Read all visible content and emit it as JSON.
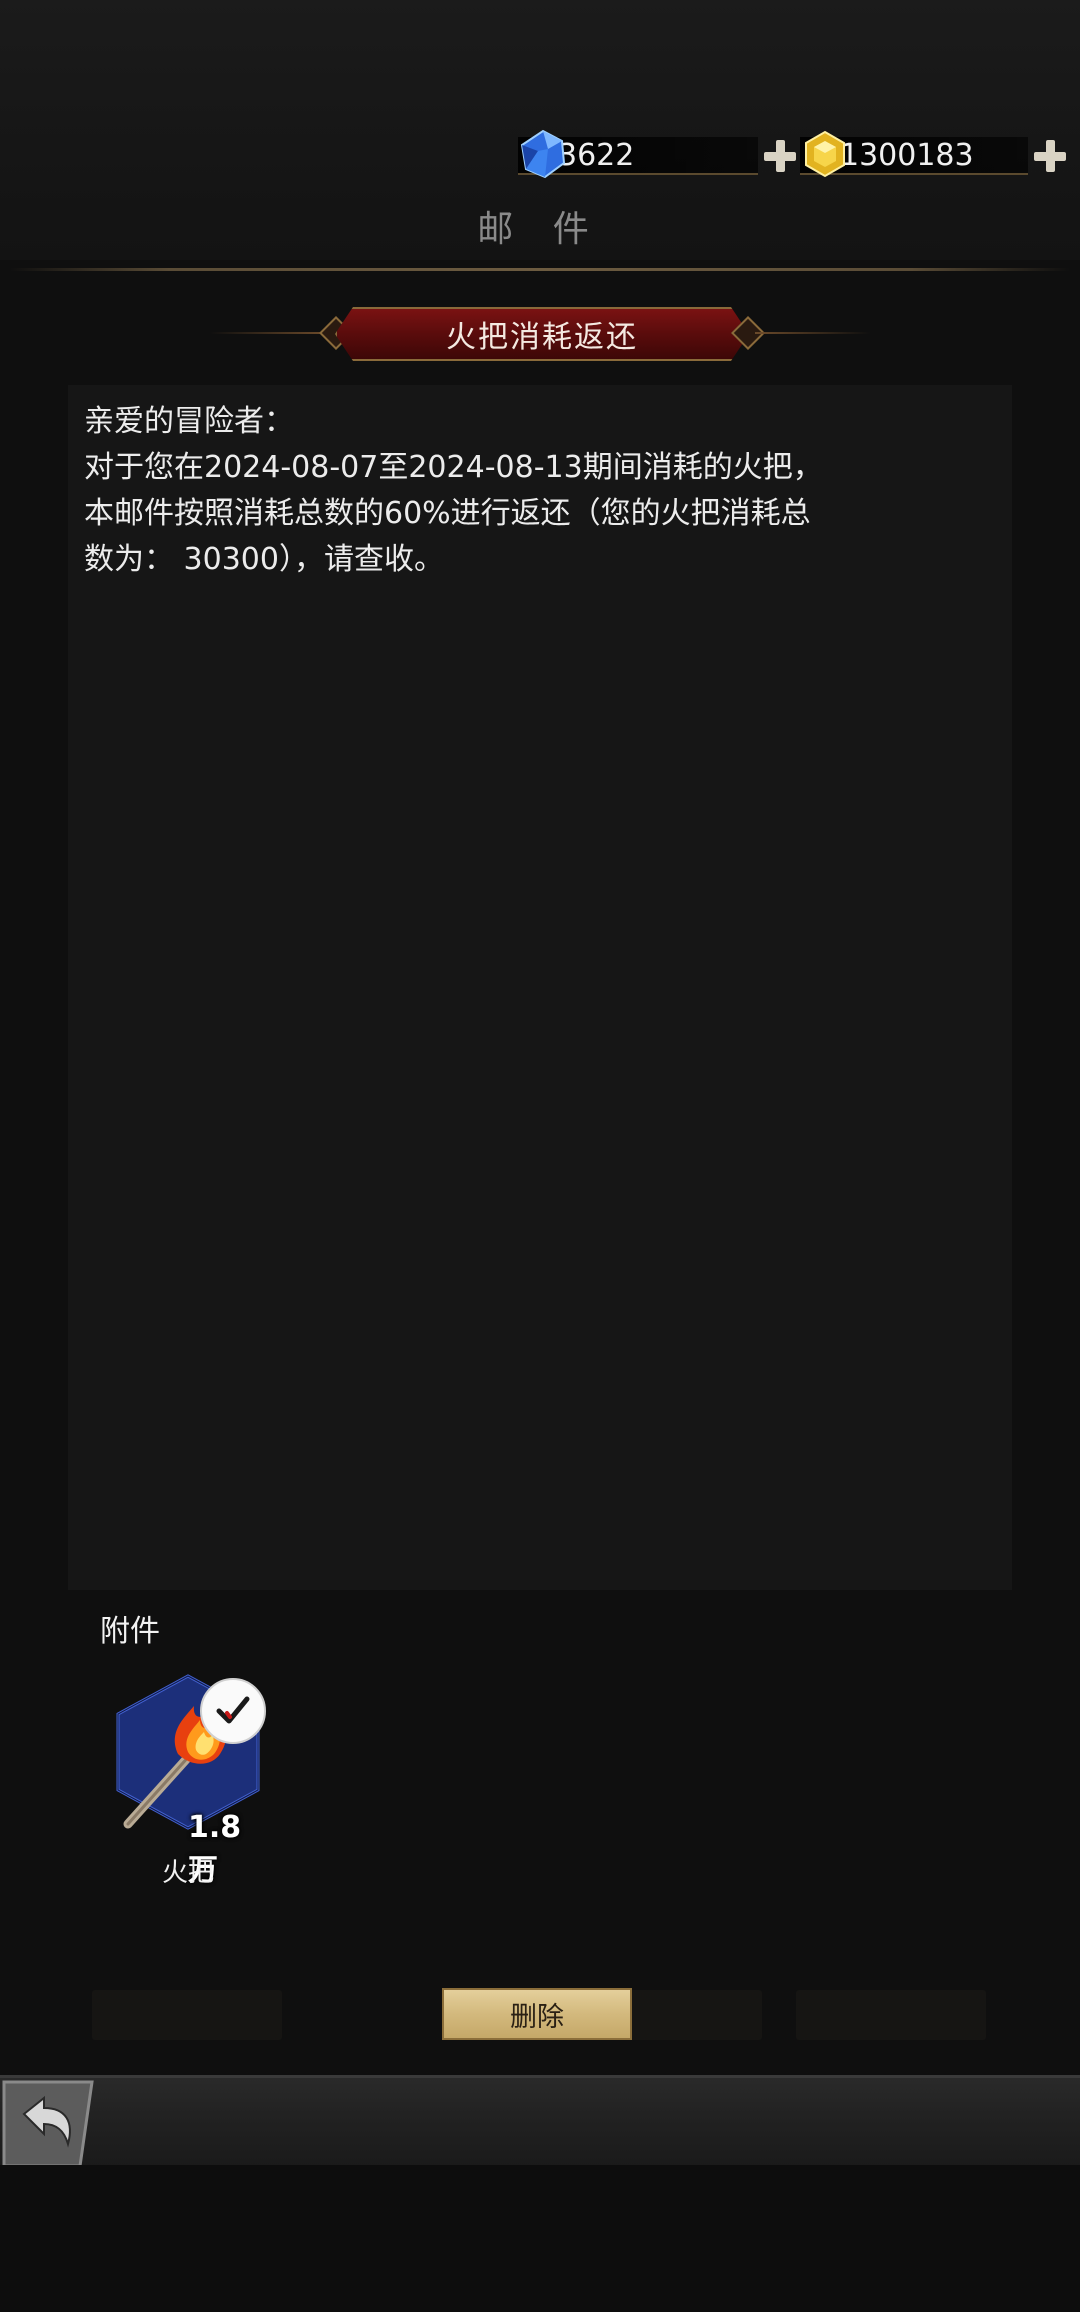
{
  "currency": {
    "diamonds": "3622",
    "gold": "1300183",
    "diamond_icon": "blue-crystal-icon",
    "gold_icon": "gold-crystal-icon",
    "add_icon": "plus-icon"
  },
  "page": {
    "title": "邮 件"
  },
  "mail": {
    "title": "火把消耗返还",
    "body_lines": [
      "亲爱的冒险者：",
      "对于您在2024-08-07至2024-08-13期间消耗的火把，",
      "本邮件按照消耗总数的60%进行返还（您的火把消耗总",
      "数为： 30300），请查收。"
    ]
  },
  "attachments": {
    "label": "附件",
    "items": [
      {
        "name": "火把",
        "count": "1.8万",
        "icon": "torch-icon",
        "claimed": true
      }
    ]
  },
  "actions": {
    "delete_label": "删除"
  },
  "colors": {
    "banner_red": "#6a0e0e",
    "gold_button": "#d3b97d",
    "hex_blue": "#1c2f7a"
  }
}
